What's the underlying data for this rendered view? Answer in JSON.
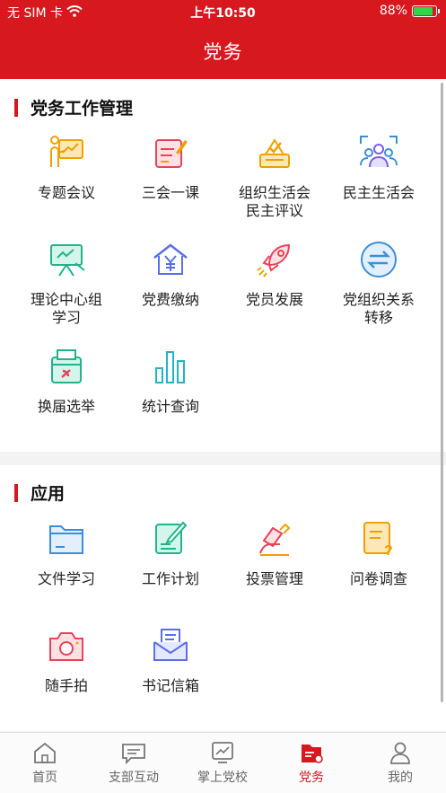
{
  "status_bar": {
    "carrier": "无 SIM 卡",
    "time": "上午10:50",
    "battery": "88%"
  },
  "header": {
    "title": "党务"
  },
  "sections": [
    {
      "title": "党务工作管理",
      "items": [
        {
          "label": "专题会议",
          "icon": "presentation-board-icon"
        },
        {
          "label": "三会一课",
          "icon": "notebook-pen-icon"
        },
        {
          "label": "组织生活会\n民主评议",
          "icon": "ballot-box-icon"
        },
        {
          "label": "民主生活会",
          "icon": "people-group-icon"
        },
        {
          "label": "理论中心组\n学习",
          "icon": "easel-icon"
        },
        {
          "label": "党费缴纳",
          "icon": "yuan-house-icon"
        },
        {
          "label": "党员发展",
          "icon": "rocket-icon"
        },
        {
          "label": "党组织关系\n转移",
          "icon": "transfer-arrows-icon"
        },
        {
          "label": "换届选举",
          "icon": "election-box-icon"
        },
        {
          "label": "统计查询",
          "icon": "bar-stats-icon"
        }
      ]
    },
    {
      "title": "应用",
      "items": [
        {
          "label": "文件学习",
          "icon": "folder-icon"
        },
        {
          "label": "工作计划",
          "icon": "plan-edit-icon"
        },
        {
          "label": "投票管理",
          "icon": "vote-hand-icon"
        },
        {
          "label": "问卷调查",
          "icon": "questionnaire-icon"
        },
        {
          "label": "随手拍",
          "icon": "camera-icon"
        },
        {
          "label": "书记信箱",
          "icon": "mailbox-icon"
        }
      ]
    }
  ],
  "tabbar": [
    {
      "label": "首页",
      "icon": "home-icon",
      "active": false
    },
    {
      "label": "支部互动",
      "icon": "chat-icon",
      "active": false
    },
    {
      "label": "掌上党校",
      "icon": "school-screen-icon",
      "active": false
    },
    {
      "label": "党务",
      "icon": "party-affairs-icon",
      "active": true
    },
    {
      "label": "我的",
      "icon": "profile-icon",
      "active": false
    }
  ],
  "colors": {
    "brand_red": "#d8181f",
    "battery_green": "#37d14a"
  }
}
